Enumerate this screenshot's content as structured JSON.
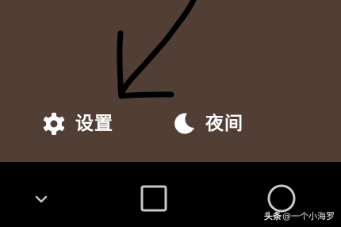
{
  "quick_panel": {
    "settings": {
      "label": "设置",
      "icon": "gear-icon"
    },
    "night_mode": {
      "label": "夜间",
      "icon": "moon-icon"
    }
  },
  "annotation": {
    "icon": "hand-drawn-arrow"
  },
  "nav_bar": {
    "collapse": {
      "icon": "chevron-down-icon"
    },
    "home": {
      "icon": "square-icon"
    },
    "recent": {
      "icon": "circle-icon"
    }
  },
  "watermark": {
    "brand": "头条",
    "handle": "@一个小海罗"
  },
  "colors": {
    "panel_bg": "#513e34",
    "nav_bg": "#000000",
    "foreground": "#ffffff",
    "annotation": "#000000"
  }
}
